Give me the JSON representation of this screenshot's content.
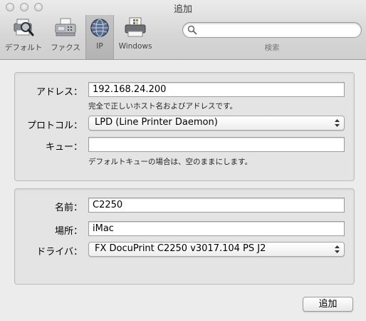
{
  "window": {
    "title": "追加"
  },
  "toolbar": {
    "items": [
      {
        "label": "デフォルト",
        "icon": "default-printer-search-icon"
      },
      {
        "label": "ファクス",
        "icon": "fax-icon"
      },
      {
        "label": "IP",
        "icon": "globe-icon",
        "selected": true
      },
      {
        "label": "Windows",
        "icon": "windows-printer-icon"
      }
    ],
    "search": {
      "value": "",
      "placeholder": "",
      "label": "検索"
    }
  },
  "connection": {
    "address": {
      "label": "アドレス：",
      "value": "192.168.24.200",
      "hint": "完全で正しいホスト名およびアドレスです。"
    },
    "protocol": {
      "label": "プロトコル：",
      "value": "LPD (Line Printer Daemon)"
    },
    "queue": {
      "label": "キュー：",
      "value": "",
      "hint": "デフォルトキューの場合は、空のままにします。"
    }
  },
  "printer": {
    "name": {
      "label": "名前：",
      "value": "C2250"
    },
    "location": {
      "label": "場所：",
      "value": "iMac"
    },
    "driver": {
      "label": "ドライバ：",
      "value": "FX DocuPrint C2250 v3017.104 PS J2"
    }
  },
  "actions": {
    "add_label": "追加"
  }
}
